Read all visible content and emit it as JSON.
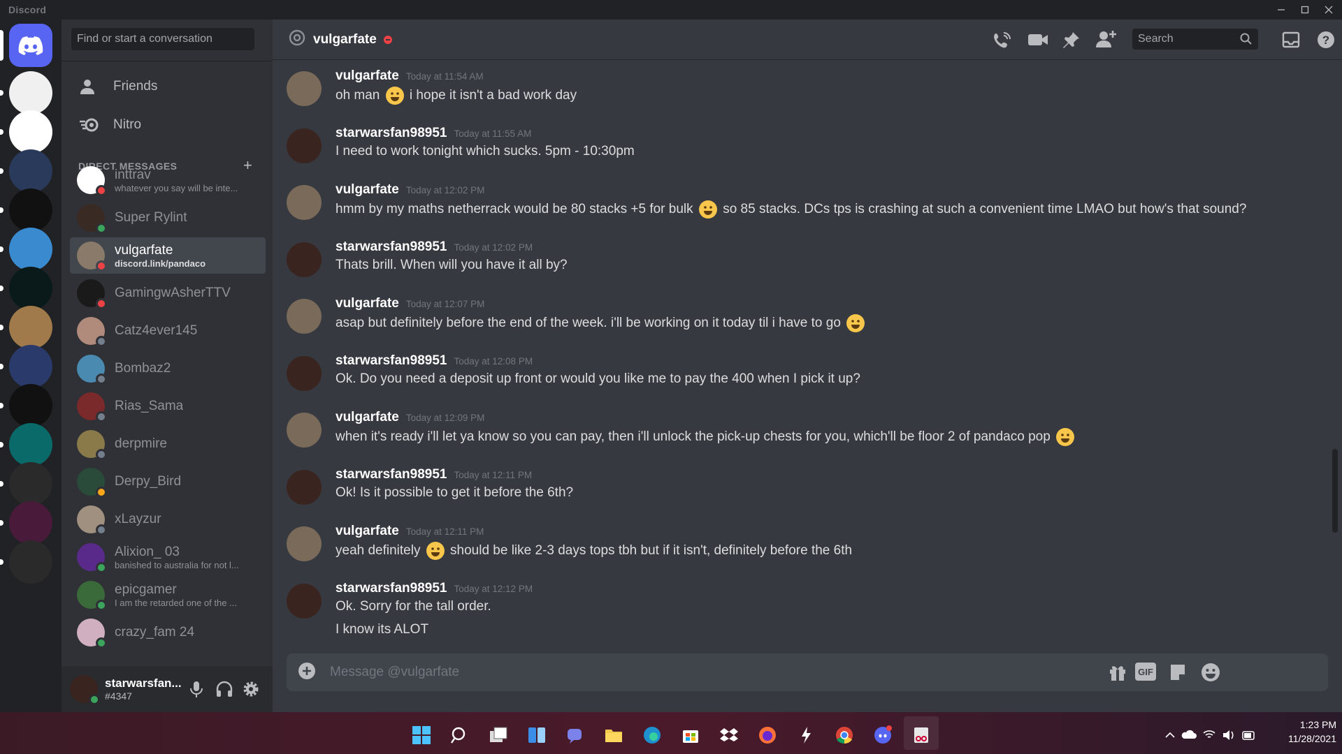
{
  "window": {
    "title": "Discord"
  },
  "sidebar": {
    "search_placeholder": "Find or start a conversation",
    "nav": [
      {
        "label": "Friends",
        "icon": "friends-icon"
      },
      {
        "label": "Nitro",
        "icon": "nitro-icon"
      }
    ],
    "dm_header": "DIRECT MESSAGES",
    "dms": [
      {
        "name": "inttrav",
        "sub": "whatever you say will be inte...",
        "status": "dnd",
        "color": "#ffffff"
      },
      {
        "name": "Super Rylint",
        "sub": "",
        "status": "online",
        "color": "#3a2a24"
      },
      {
        "name": "vulgarfate",
        "sub": "discord.link/pandaco",
        "status": "dnd",
        "color": "#8a7a6a",
        "selected": true
      },
      {
        "name": "GamingwAsherTTV",
        "sub": "",
        "status": "dnd",
        "color": "#1a1a1a"
      },
      {
        "name": "Catz4ever145",
        "sub": "",
        "status": "offline",
        "color": "#b08a7a"
      },
      {
        "name": "Bombaz2",
        "sub": "",
        "status": "offline",
        "color": "#4a8ab0"
      },
      {
        "name": "Rias_Sama",
        "sub": "",
        "status": "offline",
        "color": "#7a2a2a"
      },
      {
        "name": "derpmire",
        "sub": "",
        "status": "offline",
        "color": "#8a7a4a"
      },
      {
        "name": "Derpy_Bird",
        "sub": "",
        "status": "idle",
        "color": "#2a4a3a"
      },
      {
        "name": "xLayzur",
        "sub": "",
        "status": "offline",
        "color": "#a09080"
      },
      {
        "name": "Alixion_ 03",
        "sub": "banished to australia for not l...",
        "status": "online",
        "color": "#5a2a8a"
      },
      {
        "name": "epicgamer",
        "sub": "I am the retarded one of the ...",
        "status": "online",
        "color": "#3a6a3a"
      },
      {
        "name": "crazy_fam 24",
        "sub": "",
        "status": "online",
        "color": "#d0b0c0"
      }
    ],
    "user": {
      "name": "starwarsfan...",
      "tag": "#4347"
    }
  },
  "guilds": [
    {
      "icon": "discord-home-icon",
      "color": "#5865f2"
    },
    {
      "icon": "credit-resource-icon",
      "color": "#f0f0f0"
    },
    {
      "icon": "panda-icon",
      "color": "#ffffff"
    },
    {
      "icon": "landscape-icon",
      "color": "#2a3a5a"
    },
    {
      "icon": "uber-eats-icon",
      "color": "#111111"
    },
    {
      "icon": "ds-icon",
      "color": "#3a8ad0"
    },
    {
      "icon": "green-a-icon",
      "color": "#0a1a1a"
    },
    {
      "icon": "lion-icon",
      "color": "#a07a4a"
    },
    {
      "icon": "blue-ring-icon",
      "color": "#2a3a6a"
    },
    {
      "icon": "triangle-icon",
      "color": "#111111"
    },
    {
      "icon": "z-icon",
      "color": "#0a6a6a"
    },
    {
      "icon": "b-icon",
      "color": "#2a2a2a"
    },
    {
      "icon": "avr-icon",
      "color": "#4a1a3a"
    },
    {
      "icon": "crown-icon",
      "color": "#2a2a2a"
    }
  ],
  "chat": {
    "channel_name": "vulgarfate",
    "search_placeholder": "Search",
    "composer_placeholder": "Message @vulgarfate",
    "messages": [
      {
        "author": "vulgarfate",
        "time": "Today at 11:54 AM",
        "parts": [
          "oh man ",
          "emoji",
          " i hope it isn't a bad work day"
        ],
        "av": "#7a6a5a"
      },
      {
        "author": "starwarsfan98951",
        "time": "Today at 11:55 AM",
        "parts": [
          "I need to work tonight which sucks. 5pm - 10:30pm"
        ],
        "av": "#3a2420"
      },
      {
        "author": "vulgarfate",
        "time": "Today at 12:02 PM",
        "parts": [
          "hmm by my maths netherrack would be 80 stacks +5 for bulk ",
          "emoji",
          " so 85 stacks. DCs tps is crashing at such a convenient time LMAO but how's that sound?"
        ],
        "av": "#7a6a5a"
      },
      {
        "author": "starwarsfan98951",
        "time": "Today at 12:02 PM",
        "parts": [
          "Thats brill. When will you have it all by?"
        ],
        "av": "#3a2420"
      },
      {
        "author": "vulgarfate",
        "time": "Today at 12:07 PM",
        "parts": [
          "asap but definitely before the end of the week. i'll be working on it today til i have to go ",
          "emoji"
        ],
        "av": "#7a6a5a"
      },
      {
        "author": "starwarsfan98951",
        "time": "Today at 12:08 PM",
        "parts": [
          "Ok. Do you need a deposit up front or would you like me to pay the 400 when I pick it up?"
        ],
        "av": "#3a2420"
      },
      {
        "author": "vulgarfate",
        "time": "Today at 12:09 PM",
        "parts": [
          "when it's ready i'll let ya know so you can pay, then i'll unlock the pick-up chests for you, which'll be floor 2 of pandaco pop ",
          "emoji"
        ],
        "av": "#7a6a5a"
      },
      {
        "author": "starwarsfan98951",
        "time": "Today at 12:11 PM",
        "parts": [
          "Ok! Is it possible to get it before the 6th?"
        ],
        "av": "#3a2420"
      },
      {
        "author": "vulgarfate",
        "time": "Today at 12:11 PM",
        "parts": [
          "yeah definitely ",
          "emoji",
          " should be like 2-3 days tops tbh but if it isn't, definitely before the 6th"
        ],
        "av": "#7a6a5a"
      },
      {
        "author": "starwarsfan98951",
        "time": "Today at 12:12 PM",
        "parts": [
          "Ok. Sorry for the tall order."
        ],
        "second": "I know its ALOT",
        "av": "#3a2420"
      }
    ]
  },
  "taskbar": {
    "time": "1:23 PM",
    "date": "11/28/2021"
  },
  "colors": {
    "accent": "#5865f2",
    "online": "#3ba55d",
    "dnd": "#ed4245",
    "idle": "#faa81a",
    "offline": "#747f8d"
  }
}
